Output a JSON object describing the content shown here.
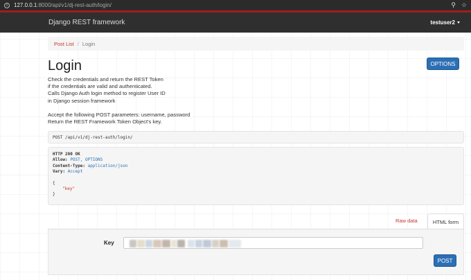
{
  "browser": {
    "url_host": "127.0.0.1",
    "url_path": ":8000/api/v1/dj-rest-auth/login/"
  },
  "navbar": {
    "brand": "Django REST framework",
    "username": "testuser2"
  },
  "breadcrumb": {
    "link": "Post List",
    "separator": "/",
    "active": "Login"
  },
  "page": {
    "title": "Login",
    "options_label": "OPTIONS",
    "description_1": [
      "Check the credentials and return the REST Token",
      "if the credentials are valid and authenticated.",
      "Calls Django Auth login method to register User ID",
      "in Django session framework"
    ],
    "description_2": [
      "Accept the following POST parameters: username, password",
      "Return the REST Framework Token Object's key."
    ]
  },
  "request": {
    "line": "POST /api/v1/dj-rest-auth/login/"
  },
  "response": {
    "status": "HTTP 200 OK",
    "allow_key": "Allow:",
    "allow_value": "POST, OPTIONS",
    "content_type_key": "Content-Type:",
    "content_type_value": "application/json",
    "vary_key": "Vary:",
    "vary_value": "Accept",
    "body_open": "{",
    "body_key": "\"key\"",
    "body_close": "}"
  },
  "tabs": {
    "raw": "Raw data",
    "html": "HTML form"
  },
  "form": {
    "key_label": "Key",
    "post_label": "POST"
  },
  "colors": {
    "accent": "#2c6fb4",
    "link": "#c0392b",
    "navbar": "#2f2f2f",
    "navbar_border": "#a51c1c"
  }
}
